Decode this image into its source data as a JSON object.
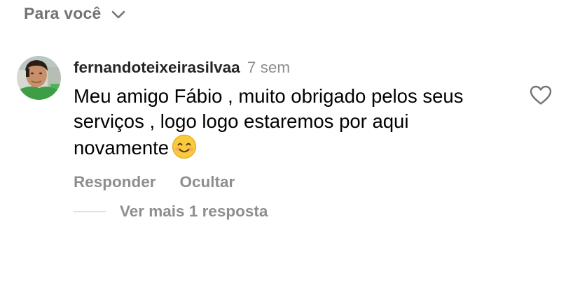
{
  "filter": {
    "label": "Para você",
    "icon": "chevron-down-icon"
  },
  "comment": {
    "username": "fernandoteixeirasilvaa",
    "time": "7 sem",
    "text": "Meu amigo Fábio , muito obrigado pelos seus serviços , logo logo estaremos por aqui novamente",
    "emoji": "smiling-face-emoji",
    "actions": {
      "reply": "Responder",
      "hide": "Ocultar"
    },
    "view_replies": "Ver mais 1 resposta",
    "like_icon": "heart-outline-icon"
  },
  "colors": {
    "primary_text": "#000000",
    "username_text": "#262626",
    "secondary_text": "#8e8e8e",
    "filter_text": "#737373",
    "divider": "#e0e0e0"
  }
}
